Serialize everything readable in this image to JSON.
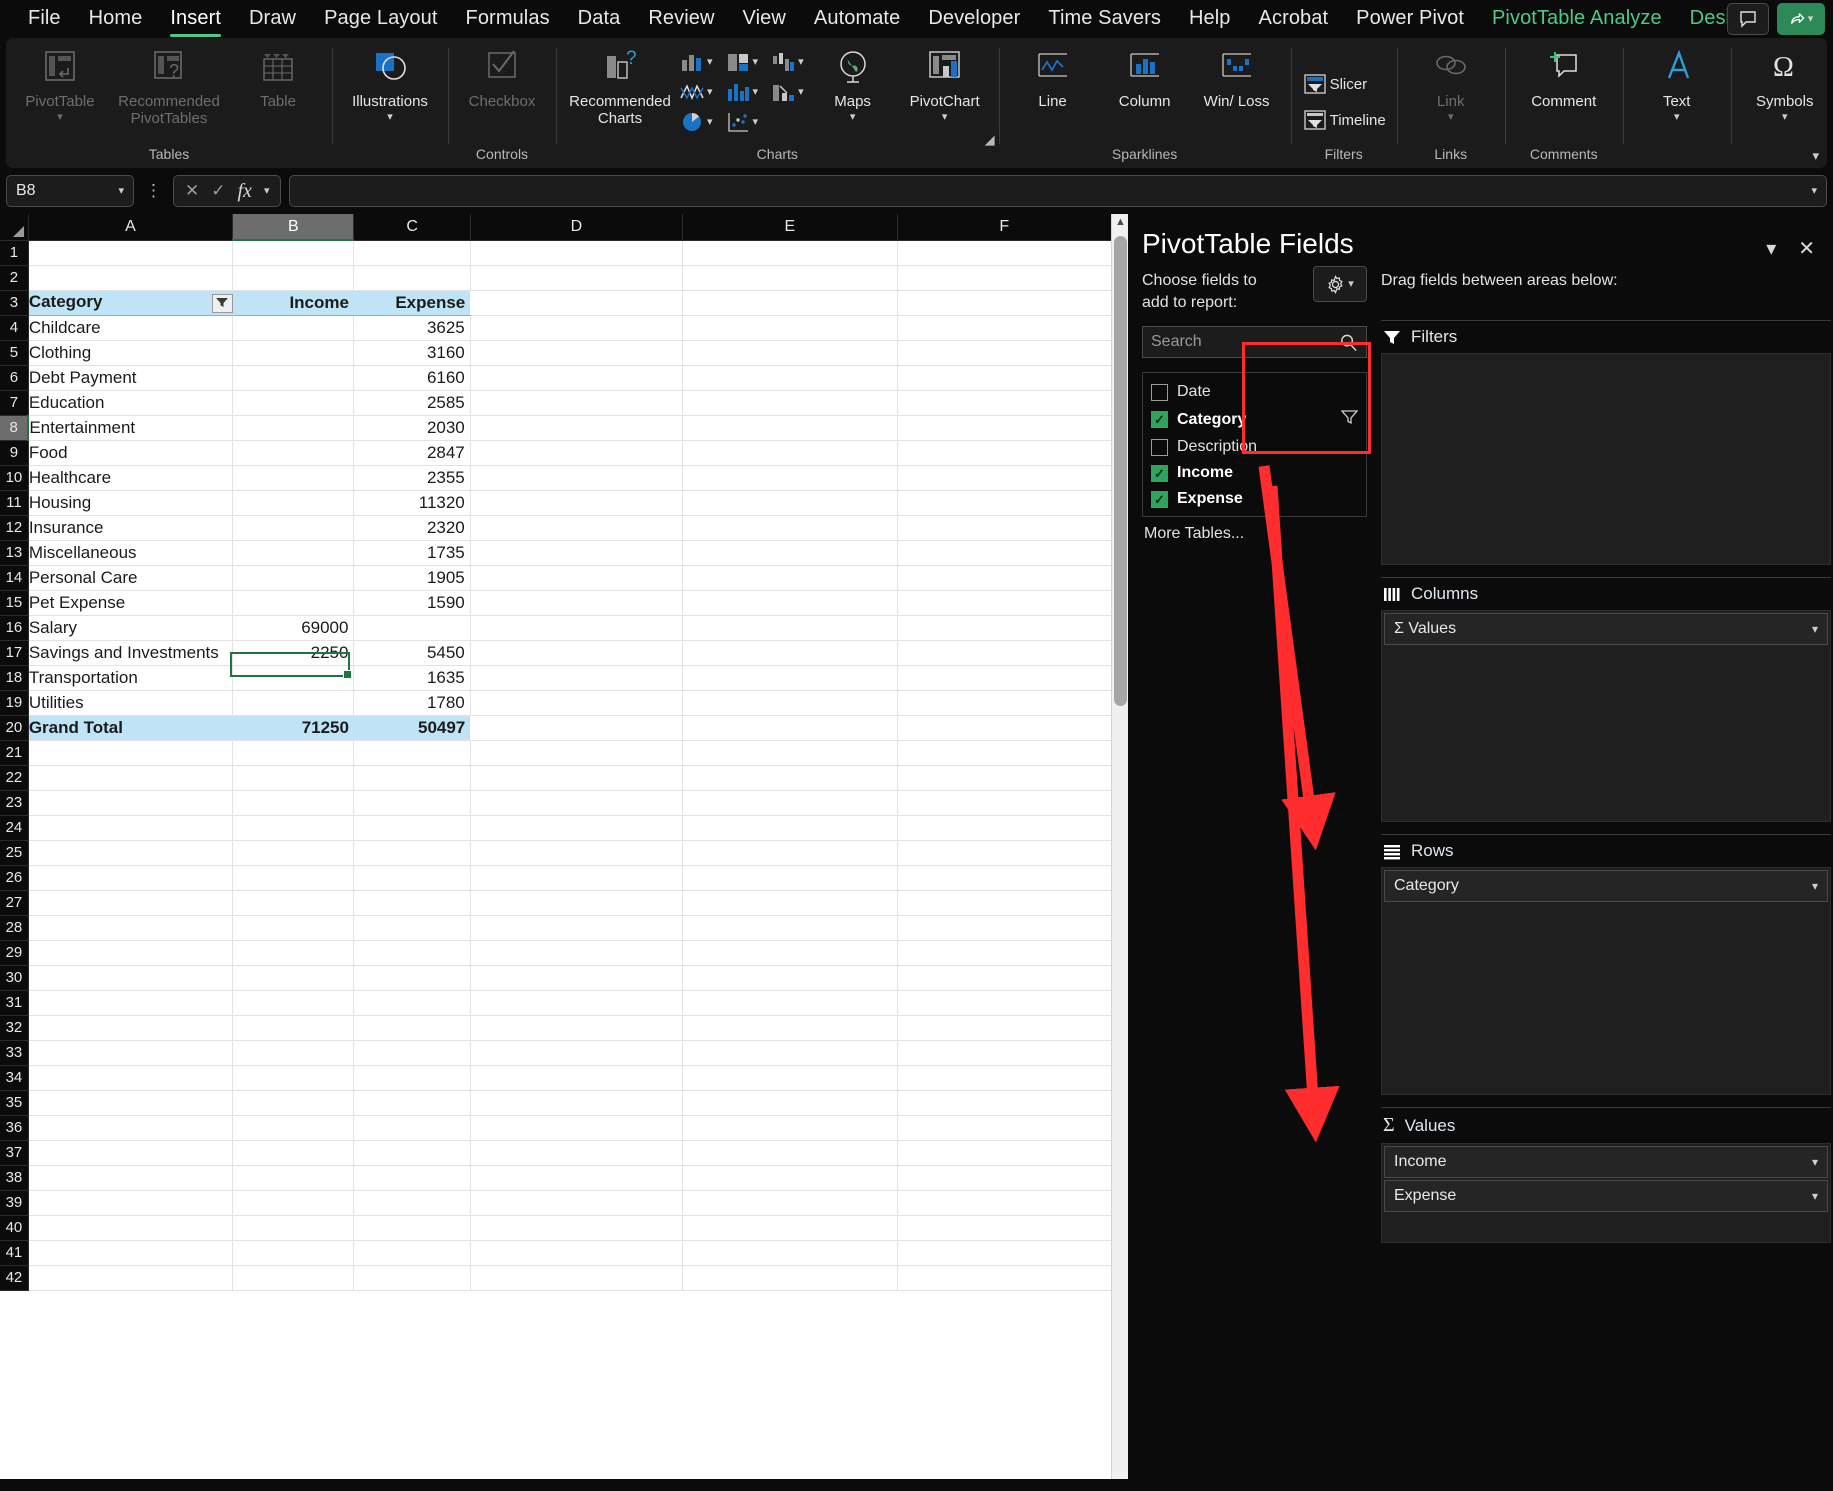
{
  "ribbon": {
    "tabs": [
      {
        "label": "File",
        "state": "normal"
      },
      {
        "label": "Home",
        "state": "normal"
      },
      {
        "label": "Insert",
        "state": "active"
      },
      {
        "label": "Draw",
        "state": "normal"
      },
      {
        "label": "Page Layout",
        "state": "normal"
      },
      {
        "label": "Formulas",
        "state": "normal"
      },
      {
        "label": "Data",
        "state": "normal"
      },
      {
        "label": "Review",
        "state": "normal"
      },
      {
        "label": "View",
        "state": "normal"
      },
      {
        "label": "Automate",
        "state": "normal"
      },
      {
        "label": "Developer",
        "state": "normal"
      },
      {
        "label": "Time Savers",
        "state": "normal"
      },
      {
        "label": "Help",
        "state": "normal"
      },
      {
        "label": "Acrobat",
        "state": "normal"
      },
      {
        "label": "Power Pivot",
        "state": "normal"
      },
      {
        "label": "PivotTable Analyze",
        "state": "green"
      },
      {
        "label": "Design",
        "state": "green"
      }
    ],
    "groups": {
      "tables": {
        "label": "Tables",
        "pivottable": "PivotTable",
        "recommended_pivottables": "Recommended PivotTables",
        "table": "Table"
      },
      "illustrations": {
        "label": "Illustrations"
      },
      "controls": {
        "label": "Controls",
        "checkbox": "Checkbox"
      },
      "charts": {
        "label": "Charts",
        "recommended_charts": "Recommended Charts",
        "maps": "Maps",
        "pivotchart": "PivotChart"
      },
      "sparklines": {
        "label": "Sparklines",
        "line": "Line",
        "column": "Column",
        "winloss": "Win/ Loss"
      },
      "filters": {
        "label": "Filters",
        "slicer": "Slicer",
        "timeline": "Timeline"
      },
      "links": {
        "label": "Links",
        "link": "Link"
      },
      "comments": {
        "label": "Comments",
        "comment": "Comment"
      },
      "text": {
        "label": "Text"
      },
      "symbols": {
        "label": "Symbols"
      }
    }
  },
  "formula_bar": {
    "name_box_value": "B8",
    "formula_value": ""
  },
  "sheet": {
    "column_headers": [
      "A",
      "B",
      "C",
      "D",
      "E",
      "F"
    ],
    "selected_column": "B",
    "selected_row": 8,
    "selected_cell": "B8",
    "pivot_headers": {
      "category": "Category",
      "income": "Income",
      "expense": "Expense"
    },
    "rows": [
      {
        "n": 1,
        "a": "",
        "b": "",
        "c": ""
      },
      {
        "n": 2,
        "a": "",
        "b": "",
        "c": ""
      },
      {
        "n": 3,
        "a": "Category",
        "b": "Income",
        "c": "Expense",
        "style": "header"
      },
      {
        "n": 4,
        "a": "Childcare",
        "b": "",
        "c": "3625"
      },
      {
        "n": 5,
        "a": "Clothing",
        "b": "",
        "c": "3160"
      },
      {
        "n": 6,
        "a": "Debt Payment",
        "b": "",
        "c": "6160"
      },
      {
        "n": 7,
        "a": "Education",
        "b": "",
        "c": "2585"
      },
      {
        "n": 8,
        "a": "Entertainment",
        "b": "",
        "c": "2030"
      },
      {
        "n": 9,
        "a": "Food",
        "b": "",
        "c": "2847"
      },
      {
        "n": 10,
        "a": "Healthcare",
        "b": "",
        "c": "2355"
      },
      {
        "n": 11,
        "a": "Housing",
        "b": "",
        "c": "11320"
      },
      {
        "n": 12,
        "a": "Insurance",
        "b": "",
        "c": "2320"
      },
      {
        "n": 13,
        "a": "Miscellaneous",
        "b": "",
        "c": "1735"
      },
      {
        "n": 14,
        "a": "Personal Care",
        "b": "",
        "c": "1905"
      },
      {
        "n": 15,
        "a": "Pet Expense",
        "b": "",
        "c": "1590"
      },
      {
        "n": 16,
        "a": "Salary",
        "b": "69000",
        "c": ""
      },
      {
        "n": 17,
        "a": "Savings and Investments",
        "b": "2250",
        "c": "5450"
      },
      {
        "n": 18,
        "a": "Transportation",
        "b": "",
        "c": "1635"
      },
      {
        "n": 19,
        "a": "Utilities",
        "b": "",
        "c": "1780"
      },
      {
        "n": 20,
        "a": "Grand Total",
        "b": "71250",
        "c": "50497",
        "style": "total"
      },
      {
        "n": 21,
        "a": "",
        "b": "",
        "c": ""
      },
      {
        "n": 22,
        "a": "",
        "b": "",
        "c": ""
      },
      {
        "n": 23,
        "a": "",
        "b": "",
        "c": ""
      },
      {
        "n": 24,
        "a": "",
        "b": "",
        "c": ""
      },
      {
        "n": 25,
        "a": "",
        "b": "",
        "c": ""
      },
      {
        "n": 26,
        "a": "",
        "b": "",
        "c": ""
      },
      {
        "n": 27,
        "a": "",
        "b": "",
        "c": ""
      },
      {
        "n": 28,
        "a": "",
        "b": "",
        "c": ""
      },
      {
        "n": 29,
        "a": "",
        "b": "",
        "c": ""
      },
      {
        "n": 30,
        "a": "",
        "b": "",
        "c": ""
      },
      {
        "n": 31,
        "a": "",
        "b": "",
        "c": ""
      },
      {
        "n": 32,
        "a": "",
        "b": "",
        "c": ""
      },
      {
        "n": 33,
        "a": "",
        "b": "",
        "c": ""
      },
      {
        "n": 34,
        "a": "",
        "b": "",
        "c": ""
      },
      {
        "n": 35,
        "a": "",
        "b": "",
        "c": ""
      },
      {
        "n": 36,
        "a": "",
        "b": "",
        "c": ""
      },
      {
        "n": 37,
        "a": "",
        "b": "",
        "c": ""
      },
      {
        "n": 38,
        "a": "",
        "b": "",
        "c": ""
      },
      {
        "n": 39,
        "a": "",
        "b": "",
        "c": ""
      },
      {
        "n": 40,
        "a": "",
        "b": "",
        "c": ""
      },
      {
        "n": 41,
        "a": "",
        "b": "",
        "c": ""
      },
      {
        "n": 42,
        "a": "",
        "b": "",
        "c": ""
      }
    ]
  },
  "pivot_panel": {
    "title": "PivotTable Fields",
    "choose_fields_label": "Choose fields to add to report:",
    "drag_fields_label": "Drag fields between areas below:",
    "search_placeholder": "Search",
    "fields": [
      {
        "label": "Date",
        "checked": false
      },
      {
        "label": "Category",
        "checked": true
      },
      {
        "label": "Description",
        "checked": false
      },
      {
        "label": "Income",
        "checked": true
      },
      {
        "label": "Expense",
        "checked": true
      }
    ],
    "more_tables": "More Tables...",
    "areas": {
      "filters": {
        "label": "Filters",
        "items": []
      },
      "columns": {
        "label": "Columns",
        "items": [
          "Σ Values"
        ]
      },
      "rows": {
        "label": "Rows",
        "items": [
          "Category"
        ]
      },
      "values": {
        "label": "Values",
        "items": [
          "Income",
          "Expense"
        ]
      }
    },
    "annotation_color": "#ff2d2d"
  }
}
